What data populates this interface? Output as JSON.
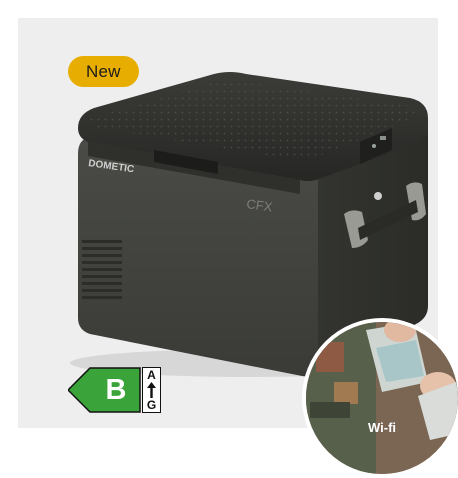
{
  "badge": {
    "label": "New"
  },
  "product": {
    "brand": "DOMETIC",
    "model_mark": "CFX"
  },
  "energy_label": {
    "class": "B",
    "scale_top": "A",
    "scale_bottom": "G",
    "color": "#3aa43a"
  },
  "inset": {
    "caption": "Wi-fi"
  },
  "colors": {
    "card_background": "#eeeeee",
    "badge_background": "#e7ad00",
    "body": "#3c3d39",
    "lid": "#2a2b28"
  }
}
